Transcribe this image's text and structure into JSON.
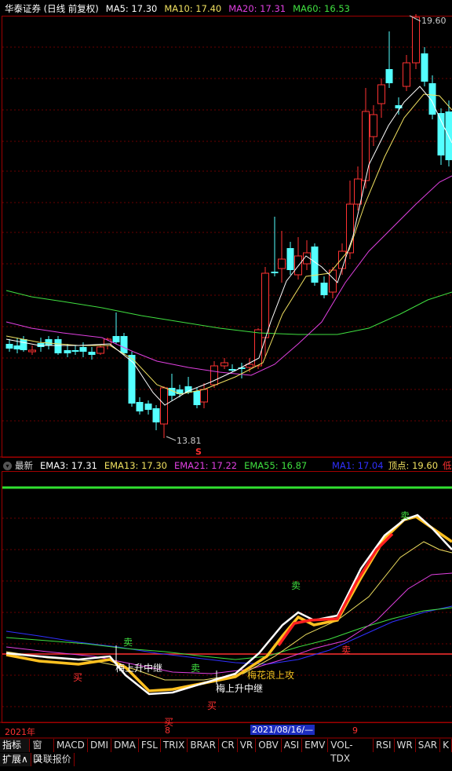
{
  "upper": {
    "title": "华泰证券 (日线 前复权)",
    "ma": [
      {
        "label": "MA5: 17.30",
        "color": "#ffffff"
      },
      {
        "label": "MA10: 17.40",
        "color": "#f0e060"
      },
      {
        "label": "MA20: 17.31",
        "color": "#e040e0"
      },
      {
        "label": "MA60: 16.53",
        "color": "#40e040"
      }
    ],
    "high_label": "19.60",
    "low_label": "13.81",
    "s_marker": "S"
  },
  "lower": {
    "title": "最新",
    "ema": [
      {
        "label": "EMA3: 17.31",
        "color": "#ffffff"
      },
      {
        "label": "EMA13: 17.30",
        "color": "#f0e060"
      },
      {
        "label": "EMA21: 17.22",
        "color": "#e040e0"
      },
      {
        "label": "EMA55: 16.87",
        "color": "#40e040"
      },
      {
        "label": "MA1: 17.04",
        "color": "#3030ff"
      },
      {
        "label": "顶点: 19.60",
        "color": "#f0e060"
      },
      {
        "label": "低点",
        "color": "#ff3030"
      }
    ],
    "annotations": {
      "sell1": "卖",
      "sell2": "卖",
      "sell3": "卖",
      "sell4": "卖",
      "sell5": "卖",
      "buy1": "买",
      "buy2": "买",
      "buy3": "买",
      "relay1": "梅上升中继",
      "relay2": "梅上升中继",
      "attack": "梅花浪上攻"
    }
  },
  "timeline": {
    "year": "2021年",
    "m8": "8",
    "date": "2021/08/16/—",
    "m9": "9"
  },
  "tabs": [
    "指标A",
    "窗口",
    "MACD",
    "DMI",
    "DMA",
    "FSL",
    "TRIX",
    "BRAR",
    "CR",
    "VR",
    "OBV",
    "ASI",
    "EMV",
    "VOL-TDX",
    "RSI",
    "WR",
    "SAR",
    "K"
  ],
  "tabs2": [
    "扩展∧",
    "关联报价"
  ],
  "colors": {
    "up": "#ff3232",
    "down": "#54ffff",
    "bg": "#000000",
    "border": "#a00000"
  }
}
